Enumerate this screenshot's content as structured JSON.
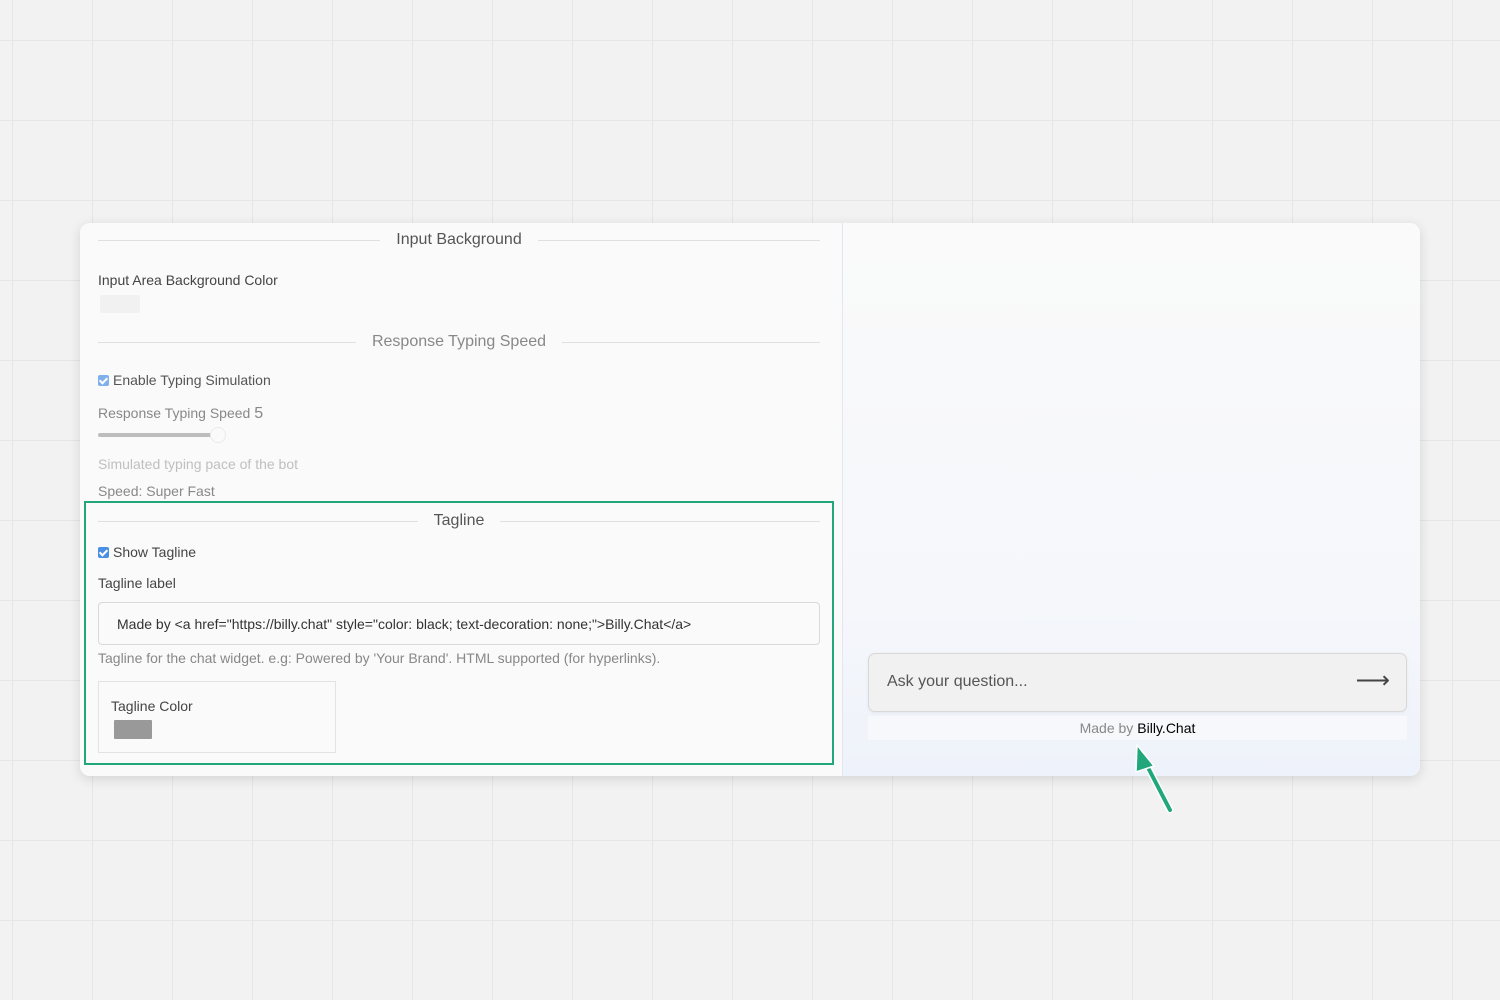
{
  "settings": {
    "input_background": {
      "section_title": "Input Background",
      "color_label": "Input Area Background Color",
      "color_value": "#f1f1f1"
    },
    "typing_speed": {
      "section_title": "Response Typing Speed",
      "enable_label": "Enable Typing Simulation",
      "enable_checked": true,
      "speed_label": "Response Typing Speed",
      "speed_value": "5",
      "help_text": "Simulated typing pace of the bot",
      "speed_text": "Speed: Super Fast"
    },
    "tagline": {
      "section_title": "Tagline",
      "show_label": "Show Tagline",
      "show_checked": true,
      "label_title": "Tagline label",
      "label_value": "Made by <a href=\"https://billy.chat\" style=\"color: black; text-decoration: none;\">Billy.Chat</a>",
      "help_text": "Tagline for the chat widget. e.g: Powered by 'Your Brand'. HTML supported (for hyperlinks).",
      "color_label": "Tagline Color",
      "color_value": "#999999"
    }
  },
  "preview": {
    "input_placeholder": "Ask your question...",
    "send_icon": "arrow-right-icon",
    "tagline_prefix": "Made by",
    "tagline_brand": "Billy.Chat"
  },
  "colors": {
    "highlight": "#22a77c",
    "checkbox": "#4a90e2"
  }
}
